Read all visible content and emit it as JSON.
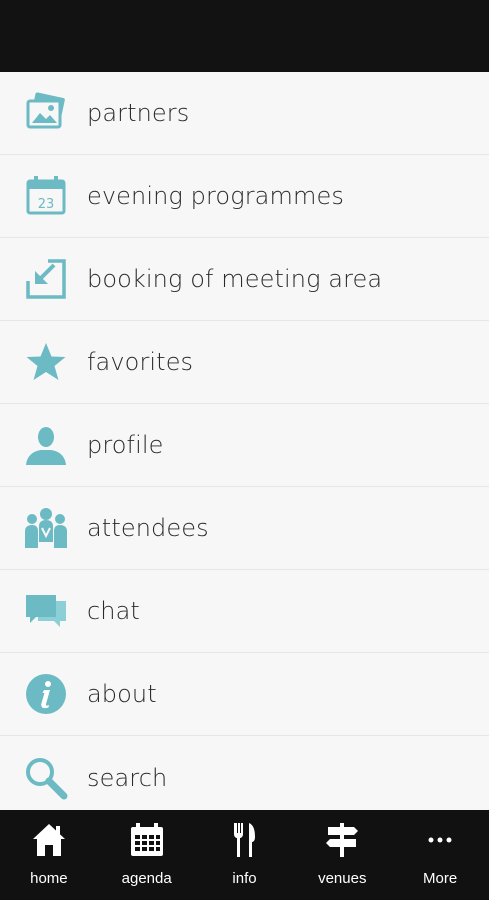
{
  "accent_color": "#6cbac4",
  "menu": {
    "items": [
      {
        "label": "partners",
        "icon": "pictures-icon"
      },
      {
        "label": "evening programmes",
        "icon": "calendar-icon"
      },
      {
        "label": "booking of meeting area",
        "icon": "booking-arrow-icon"
      },
      {
        "label": "favorites",
        "icon": "star-icon"
      },
      {
        "label": "profile",
        "icon": "person-icon"
      },
      {
        "label": "attendees",
        "icon": "people-icon"
      },
      {
        "label": "chat",
        "icon": "chat-bubbles-icon"
      },
      {
        "label": "about",
        "icon": "info-icon"
      },
      {
        "label": "search",
        "icon": "search-icon"
      }
    ],
    "calendar_day": "23"
  },
  "bottom_nav": {
    "items": [
      {
        "label": "home",
        "icon": "home-icon"
      },
      {
        "label": "agenda",
        "icon": "agenda-calendar-icon"
      },
      {
        "label": "info",
        "icon": "fork-knife-icon"
      },
      {
        "label": "venues",
        "icon": "signpost-icon"
      },
      {
        "label": "More",
        "icon": "more-dots-icon"
      }
    ]
  }
}
